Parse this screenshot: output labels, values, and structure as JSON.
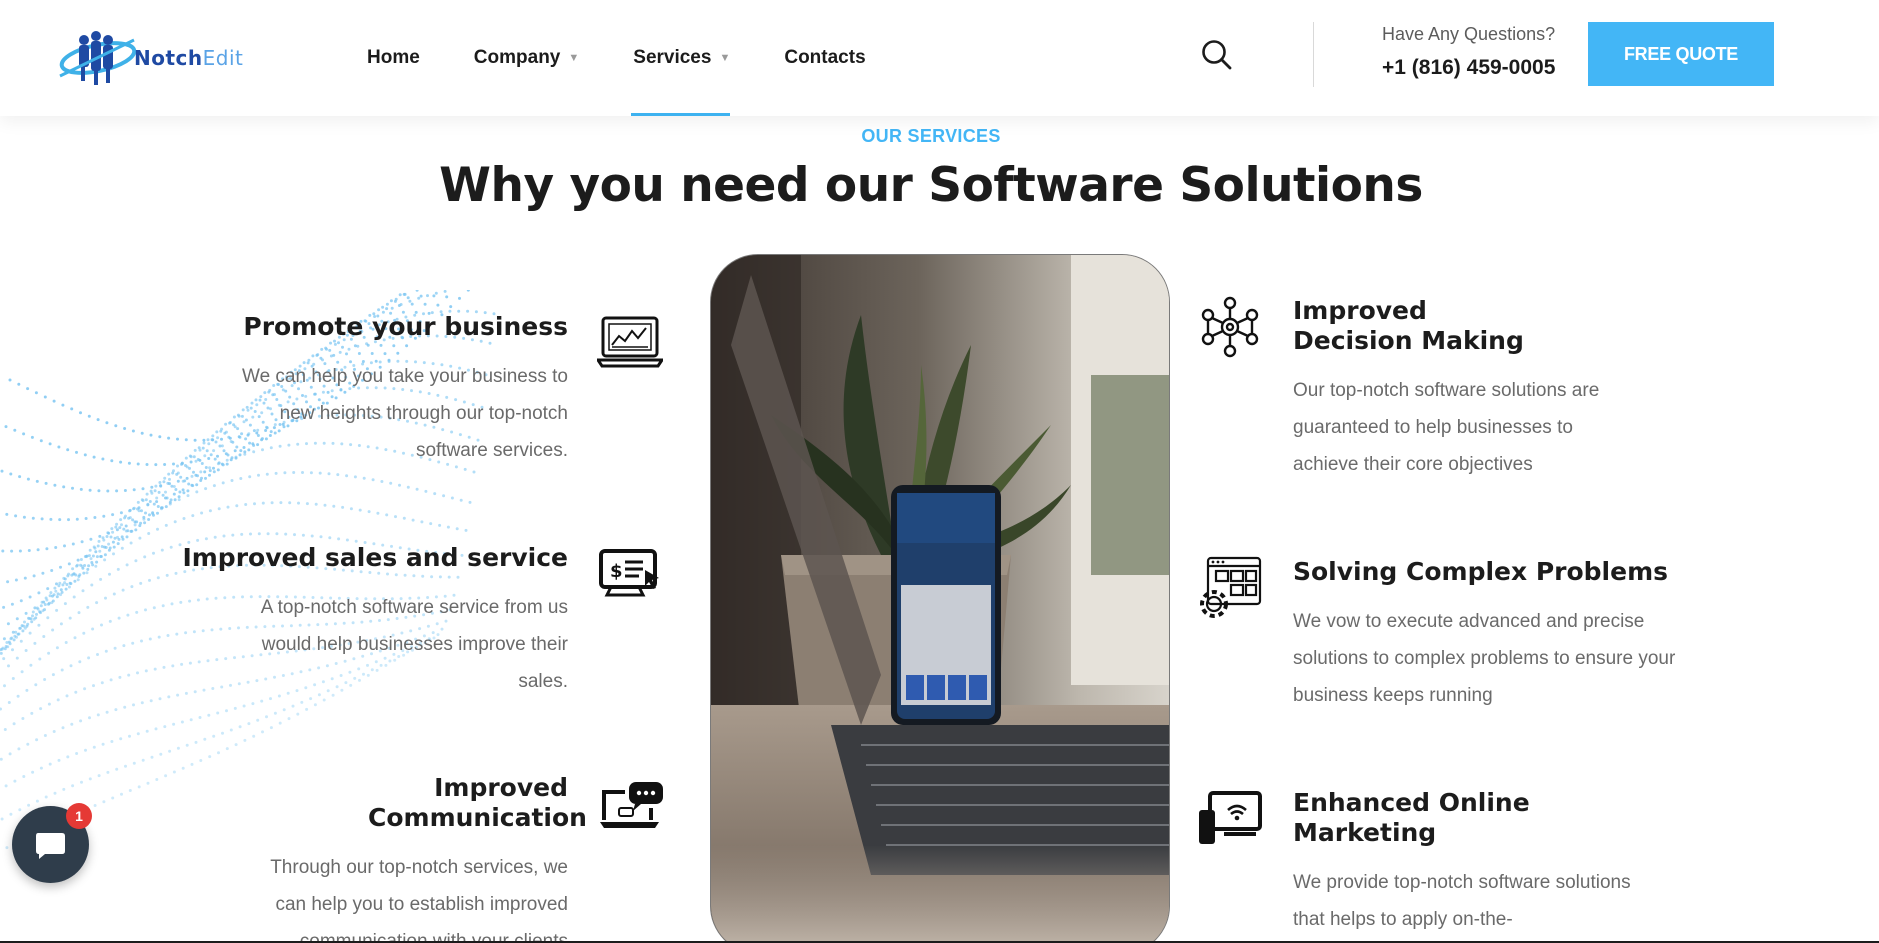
{
  "brand": {
    "logo_part1": "Notch",
    "logo_part2": "Edit",
    "primary_color": "#1f4aa3",
    "accent_color": "#43b6f6"
  },
  "nav": {
    "items": [
      {
        "label": "Home",
        "has_dropdown": false
      },
      {
        "label": "Company",
        "has_dropdown": true
      },
      {
        "label": "Services",
        "has_dropdown": true,
        "active": true
      },
      {
        "label": "Contacts",
        "has_dropdown": false
      }
    ],
    "search_icon": "search-icon"
  },
  "contact": {
    "question_label": "Have Any Questions?",
    "phone": "+1 (816) 459-0005",
    "cta_label": "FREE QUOTE"
  },
  "section": {
    "eyebrow": "OUR SERVICES",
    "title": "Why you need our Software Solutions"
  },
  "features_left": [
    {
      "title": "Promote your business",
      "text": "We can help you take your business to new heights through our top-notch software services.",
      "icon": "laptop-chart-icon"
    },
    {
      "title": "Improved sales and service",
      "text": "A top-notch software service from us would help businesses improve their sales.",
      "icon": "monitor-dollar-icon"
    },
    {
      "title": "Improved Communication",
      "text": "Through our top-notch services, we can help you to establish improved communication with your clients",
      "icon": "laptop-chat-icon"
    }
  ],
  "features_right": [
    {
      "title": "Improved Decision Making",
      "text": "Our top-notch software solutions are guaranteed to help businesses to achieve their core objectives",
      "icon": "network-nodes-icon"
    },
    {
      "title": "Solving Complex Problems",
      "text": "We vow to execute advanced and precise solutions to complex problems to ensure your business keeps running",
      "icon": "browser-gear-icon"
    },
    {
      "title": "Enhanced Online Marketing",
      "text": "We provide top-notch software solutions that helps to apply on-the-",
      "icon": "monitor-wifi-icon"
    }
  ],
  "chat": {
    "badge_count": "1",
    "icon": "chat-bubble-icon"
  }
}
